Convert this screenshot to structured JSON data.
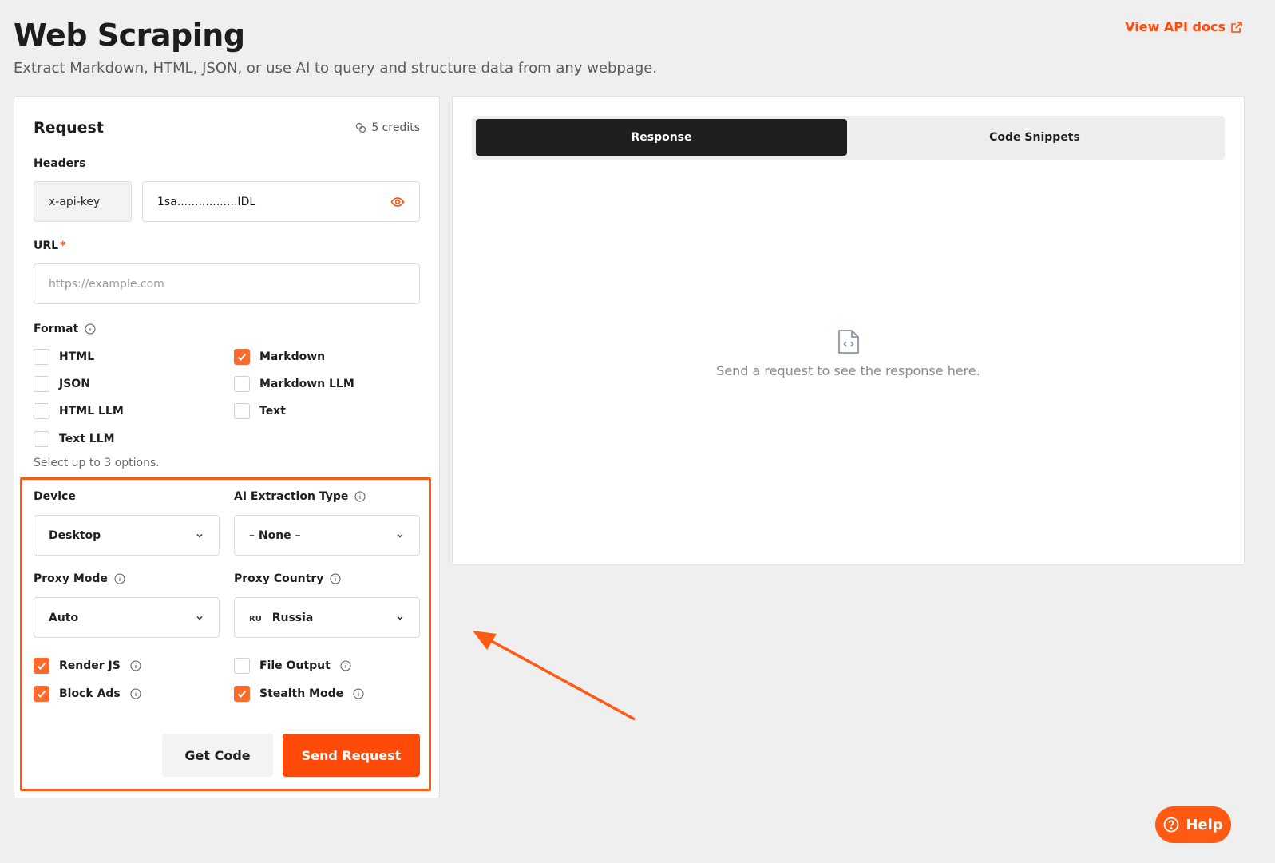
{
  "page": {
    "title": "Web Scraping",
    "subtitle": "Extract Markdown, HTML, JSON, or use AI to query and structure data from any webpage.",
    "api_docs_label": "View API docs"
  },
  "request": {
    "title": "Request",
    "credits": "5 credits",
    "headers_label": "Headers",
    "header_key": "x-api-key",
    "header_value": "1sa.................IDL",
    "url_label": "URL",
    "url_required": "*",
    "url_placeholder": "https://example.com",
    "format_label": "Format",
    "formats": [
      {
        "label": "HTML",
        "checked": false
      },
      {
        "label": "Markdown",
        "checked": true
      },
      {
        "label": "JSON",
        "checked": false
      },
      {
        "label": "Markdown LLM",
        "checked": false
      },
      {
        "label": "HTML LLM",
        "checked": false
      },
      {
        "label": "Text",
        "checked": false
      },
      {
        "label": "Text LLM",
        "checked": false
      }
    ],
    "format_hint": "Select up to 3 options.",
    "device_label": "Device",
    "device_value": "Desktop",
    "ai_extraction_label": "AI Extraction Type",
    "ai_extraction_value": "– None –",
    "proxy_mode_label": "Proxy Mode",
    "proxy_mode_value": "Auto",
    "proxy_country_label": "Proxy Country",
    "proxy_country_code": "RU",
    "proxy_country_value": "Russia",
    "options": [
      {
        "label": "Render JS",
        "checked": true
      },
      {
        "label": "File Output",
        "checked": false
      },
      {
        "label": "Block Ads",
        "checked": true
      },
      {
        "label": "Stealth Mode",
        "checked": true
      }
    ],
    "get_code_label": "Get Code",
    "send_label": "Send Request"
  },
  "response": {
    "tabs": [
      "Response",
      "Code Snippets"
    ],
    "active_tab": "Response",
    "empty_text": "Send a request to see the response here."
  },
  "help_label": "Help",
  "colors": {
    "accent": "#ff4a0a",
    "checkbox": "#ff6a2b",
    "dark": "#1f1f1f"
  }
}
